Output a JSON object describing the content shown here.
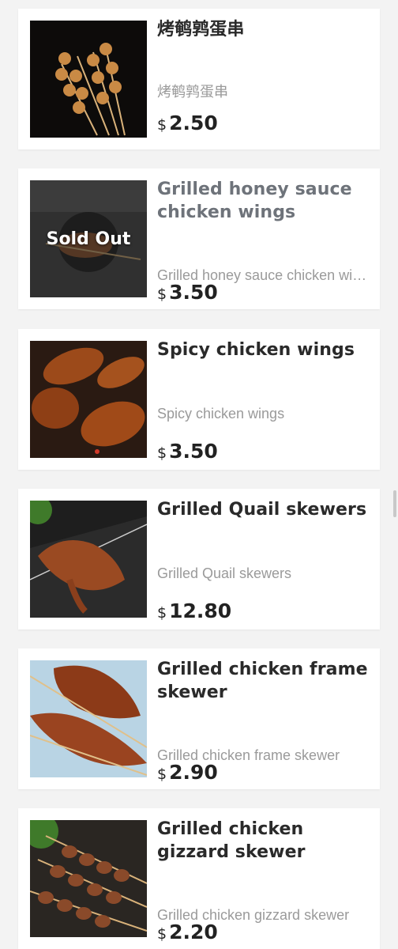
{
  "currency_symbol": "$",
  "items": [
    {
      "name": "烤鹌鹑蛋串",
      "description": "烤鹌鹑蛋串",
      "price": "2.50",
      "sold_out": false,
      "image": "quail-egg-skewers-image"
    },
    {
      "name": "Grilled honey sauce chicken wings",
      "description": "Grilled honey sauce chicken wings",
      "price": "3.50",
      "sold_out": true,
      "sold_out_label": "Sold Out",
      "image": "honey-chicken-wings-image"
    },
    {
      "name": "Spicy chicken wings",
      "description": "Spicy chicken wings",
      "price": "3.50",
      "sold_out": false,
      "image": "spicy-chicken-wings-image"
    },
    {
      "name": "Grilled Quail skewers",
      "description": "Grilled Quail skewers",
      "price": "12.80",
      "sold_out": false,
      "image": "quail-skewers-image"
    },
    {
      "name": "Grilled chicken frame skewer",
      "description": "Grilled chicken frame skewer",
      "price": "2.90",
      "sold_out": false,
      "image": "chicken-frame-skewer-image"
    },
    {
      "name": "Grilled chicken gizzard skewer",
      "description": "Grilled chicken gizzard skewer",
      "price": "2.20",
      "sold_out": false,
      "image": "chicken-gizzard-skewer-image"
    }
  ]
}
